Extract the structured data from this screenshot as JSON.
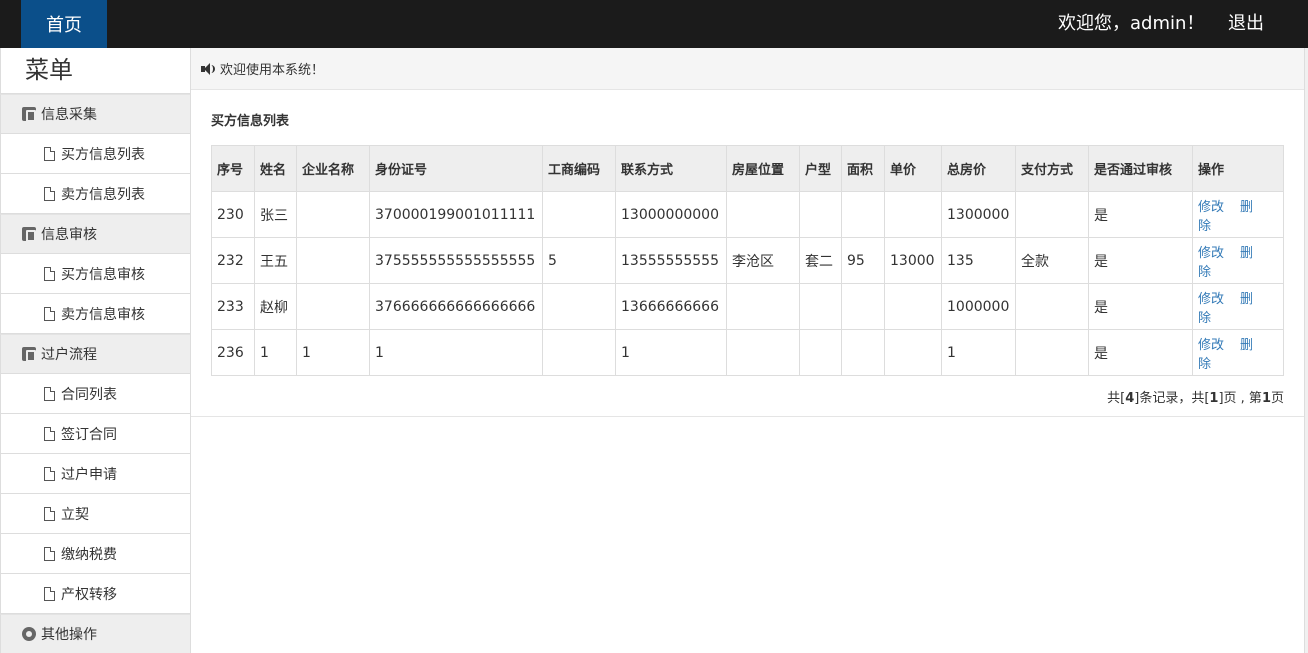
{
  "topbar": {
    "home": "首页",
    "welcome": "欢迎您，admin！",
    "logout": "退出"
  },
  "sidebar": {
    "title": "菜单",
    "groups": [
      {
        "label": "信息采集",
        "items": [
          "买方信息列表",
          "卖方信息列表"
        ]
      },
      {
        "label": "信息审核",
        "items": [
          "买方信息审核",
          "卖方信息审核"
        ]
      },
      {
        "label": "过户流程",
        "items": [
          "合同列表",
          "签订合同",
          "过户申请",
          "立契",
          "缴纳税费",
          "产权转移"
        ]
      },
      {
        "label": "其他操作",
        "items": []
      }
    ]
  },
  "main": {
    "notice": "欢迎使用本系统！",
    "list_title": "买方信息列表",
    "columns": [
      "序号",
      "姓名",
      "企业名称",
      "身份证号",
      "工商编码",
      "联系方式",
      "房屋位置",
      "户型",
      "面积",
      "单价",
      "总房价",
      "支付方式",
      "是否通过审核",
      "操作"
    ],
    "rows": [
      [
        "230",
        "张三",
        "",
        "370000199001011111",
        "",
        "13000000000",
        "",
        "",
        "",
        "",
        "1300000",
        "",
        "是"
      ],
      [
        "232",
        "王五",
        "",
        "375555555555555555",
        "5",
        "13555555555",
        "李沧区",
        "套二",
        "95",
        "13000",
        "135",
        "全款",
        "是"
      ],
      [
        "233",
        "赵柳",
        "",
        "376666666666666666",
        "",
        "13666666666",
        "",
        "",
        "",
        "",
        "1000000",
        "",
        "是"
      ],
      [
        "236",
        "1",
        "1",
        "1",
        "",
        "1",
        "",
        "",
        "",
        "",
        "1",
        "",
        "是"
      ]
    ],
    "actions": {
      "edit": "修改",
      "delete": "删除"
    },
    "pager": {
      "prefix": "共[",
      "total": "4",
      "mid1": "]条记录，共[",
      "pages": "1",
      "mid2": "]页 , 第",
      "current": "1",
      "suffix": "页"
    }
  },
  "colors": {
    "topbar": "#1b1b1b",
    "home_tab": "#0b4f8a",
    "link": "#337ab7"
  }
}
